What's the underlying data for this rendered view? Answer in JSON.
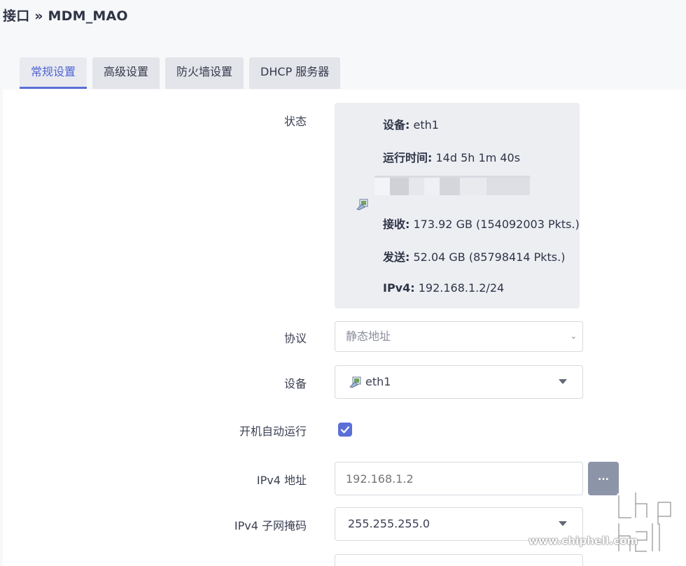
{
  "breadcrumb": "接口 » MDM_MAO",
  "tabs": [
    {
      "label": "常规设置",
      "active": true
    },
    {
      "label": "高级设置",
      "active": false
    },
    {
      "label": "防火墙设置",
      "active": false
    },
    {
      "label": "DHCP 服务器",
      "active": false
    }
  ],
  "status": {
    "label": "状态",
    "device_key": "设备:",
    "device_val": "eth1",
    "uptime_key": "运行时间:",
    "uptime_val": "14d 5h 1m 40s",
    "rx_key": "接收:",
    "rx_val": "173.92 GB (154092003 Pkts.)",
    "tx_key": "发送:",
    "tx_val": "52.04 GB (85798414 Pkts.)",
    "ipv4_key": "IPv4:",
    "ipv4_val": "192.168.1.2/24"
  },
  "protocol": {
    "label": "协议",
    "value": "静态地址"
  },
  "device": {
    "label": "设备",
    "value": "eth1"
  },
  "autostart": {
    "label": "开机自动运行",
    "checked": true
  },
  "ipv4_address": {
    "label": "IPv4 地址",
    "placeholder": "192.168.1.2",
    "more": "..."
  },
  "ipv4_netmask": {
    "label": "IPv4 子网掩码",
    "value": "255.255.255.0"
  },
  "watermark": {
    "brand": "chip hell",
    "url": "www.chiphell.com"
  },
  "colors": {
    "accent": "#5a6fd8",
    "tab_bg": "#e3e5ea",
    "status_bg": "#eceef2"
  }
}
